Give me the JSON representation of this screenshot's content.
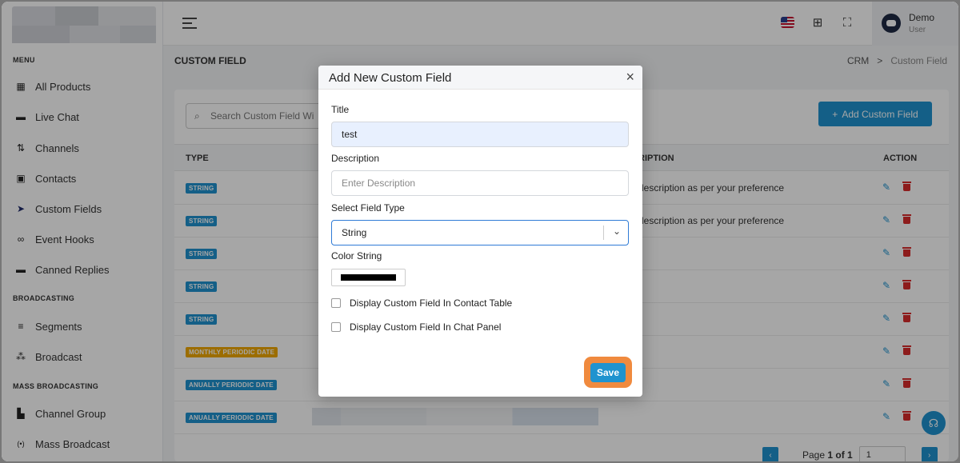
{
  "sidebar": {
    "sections": [
      "MENU",
      "BROADCASTING",
      "MASS BROADCASTING"
    ],
    "items": [
      {
        "label": "All Products",
        "icon": "grid-icon"
      },
      {
        "label": "Live Chat",
        "icon": "chat-bubble-icon"
      },
      {
        "label": "Channels",
        "icon": "channels-icon"
      },
      {
        "label": "Contacts",
        "icon": "contact-card-icon"
      },
      {
        "label": "Custom Fields",
        "icon": "tag-icon"
      },
      {
        "label": "Event Hooks",
        "icon": "link-icon"
      },
      {
        "label": "Canned Replies",
        "icon": "message-icon"
      },
      {
        "label": "Segments",
        "icon": "filter-icon"
      },
      {
        "label": "Broadcast",
        "icon": "broadcast-icon"
      },
      {
        "label": "Channel Group",
        "icon": "channel-group-icon"
      },
      {
        "label": "Mass Broadcast",
        "icon": "antenna-icon"
      }
    ]
  },
  "header": {
    "user_name": "Demo",
    "user_role": "User"
  },
  "page": {
    "title": "CUSTOM FIELD",
    "breadcrumb_root": "CRM",
    "breadcrumb_sep": ">",
    "breadcrumb_current": "Custom Field"
  },
  "toolbar": {
    "search_placeholder": "Search Custom Field Wi",
    "add_button": "Add Custom Field",
    "add_plus": "+"
  },
  "table": {
    "headers": {
      "type": "TYPE",
      "description": "RIPTION",
      "action": "ACTION"
    },
    "rows": [
      {
        "type": "STRING",
        "badge_color": "#1f93cf",
        "description": "description as per your preference"
      },
      {
        "type": "STRING",
        "badge_color": "#1f93cf",
        "description": "description as per your preference"
      },
      {
        "type": "STRING",
        "badge_color": "#1f93cf",
        "description": ""
      },
      {
        "type": "STRING",
        "badge_color": "#1f93cf",
        "description": ""
      },
      {
        "type": "STRING",
        "badge_color": "#1f93cf",
        "description": ""
      },
      {
        "type": "MONTHLY PERIODIC DATE",
        "badge_color": "#f0a800",
        "description": ""
      },
      {
        "type": "ANUALLY PERIODIC DATE",
        "badge_color": "#1f93cf",
        "description": ""
      },
      {
        "type": "ANUALLY PERIODIC DATE",
        "badge_color": "#1f93cf",
        "description": ""
      }
    ]
  },
  "pagination": {
    "prev": "‹",
    "next": "›",
    "page_prefix": "Page",
    "page_value": "1 of 1",
    "input_value": "1"
  },
  "modal": {
    "title": "Add New Custom Field",
    "close": "×",
    "title_label": "Title",
    "title_value": "test",
    "description_label": "Description",
    "description_placeholder": "Enter Description",
    "field_type_label": "Select Field Type",
    "field_type_value": "String",
    "color_label": "Color String",
    "color_value": "#000000",
    "checkbox_contact_table": "Display Custom Field In Contact Table",
    "checkbox_chat_panel": "Display Custom Field In Chat Panel",
    "save_button": "Save"
  },
  "colors": {
    "accent": "#1f93cf",
    "highlight": "#f08a3e",
    "warning_badge": "#f0a800",
    "delete": "#d92b2b"
  }
}
